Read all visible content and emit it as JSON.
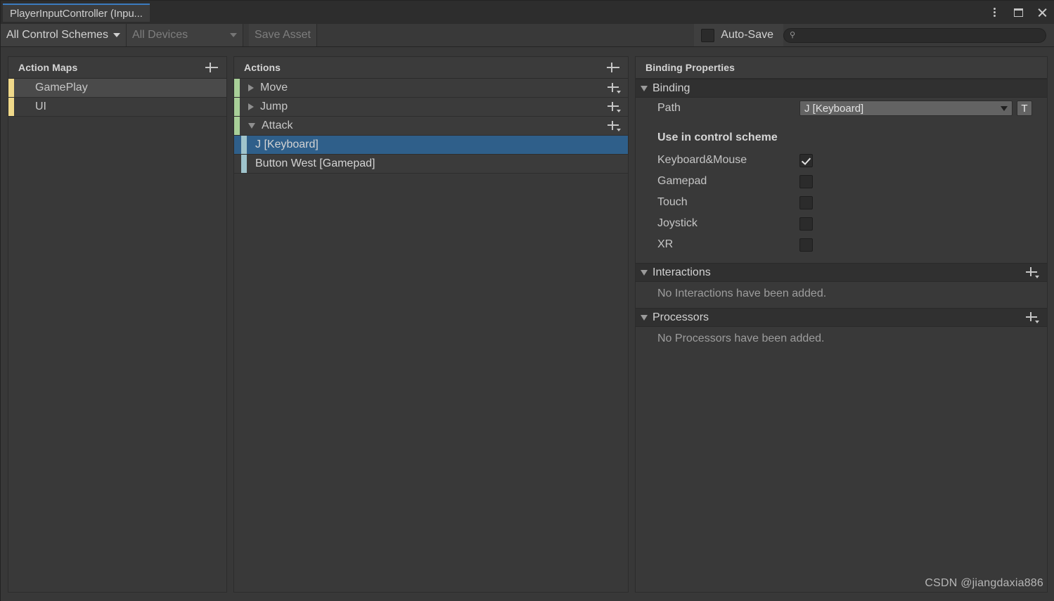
{
  "window": {
    "tab_title": "PlayerInputController (Inpu...",
    "controls": {
      "menu_icon": "kebab-menu-icon",
      "maximize_icon": "maximize-icon",
      "close_icon": "close-icon"
    }
  },
  "toolbar": {
    "control_schemes_label": "All Control Schemes",
    "devices_label": "All Devices",
    "save_asset_label": "Save Asset",
    "auto_save_label": "Auto-Save",
    "auto_save_checked": false,
    "search_placeholder": "",
    "search_value": ""
  },
  "action_maps": {
    "header": "Action Maps",
    "add_label": "+",
    "items": [
      {
        "label": "GamePlay",
        "selected": true
      },
      {
        "label": "UI",
        "selected": false
      }
    ]
  },
  "actions": {
    "header": "Actions",
    "add_label": "+",
    "items": [
      {
        "label": "Move",
        "expanded": false,
        "type": "action"
      },
      {
        "label": "Jump",
        "expanded": false,
        "type": "action"
      },
      {
        "label": "Attack",
        "expanded": true,
        "type": "action"
      },
      {
        "label": "J [Keyboard]",
        "type": "binding",
        "selected": true
      },
      {
        "label": "Button West [Gamepad]",
        "type": "binding",
        "selected": false
      }
    ]
  },
  "binding_properties": {
    "header": "Binding Properties",
    "binding": {
      "title": "Binding",
      "path_label": "Path",
      "path_value": "J [Keyboard]",
      "path_picker_label": "T",
      "scheme_title": "Use in control scheme",
      "schemes": [
        {
          "label": "Keyboard&Mouse",
          "checked": true
        },
        {
          "label": "Gamepad",
          "checked": false
        },
        {
          "label": "Touch",
          "checked": false
        },
        {
          "label": "Joystick",
          "checked": false
        },
        {
          "label": "XR",
          "checked": false
        }
      ]
    },
    "interactions": {
      "title": "Interactions",
      "empty_text": "No Interactions have been added."
    },
    "processors": {
      "title": "Processors",
      "empty_text": "No Processors have been added."
    }
  },
  "watermark": "CSDN @jiangdaxia886",
  "colors": {
    "selection_blue": "#2f5f8a",
    "tab_accent": "#3b7bbf",
    "map_stripe": "#f0d98a",
    "action_stripe": "#a8cf98",
    "binding_stripe": "#9fc4cc",
    "panel_bg": "#393939",
    "window_bg": "#383838"
  }
}
